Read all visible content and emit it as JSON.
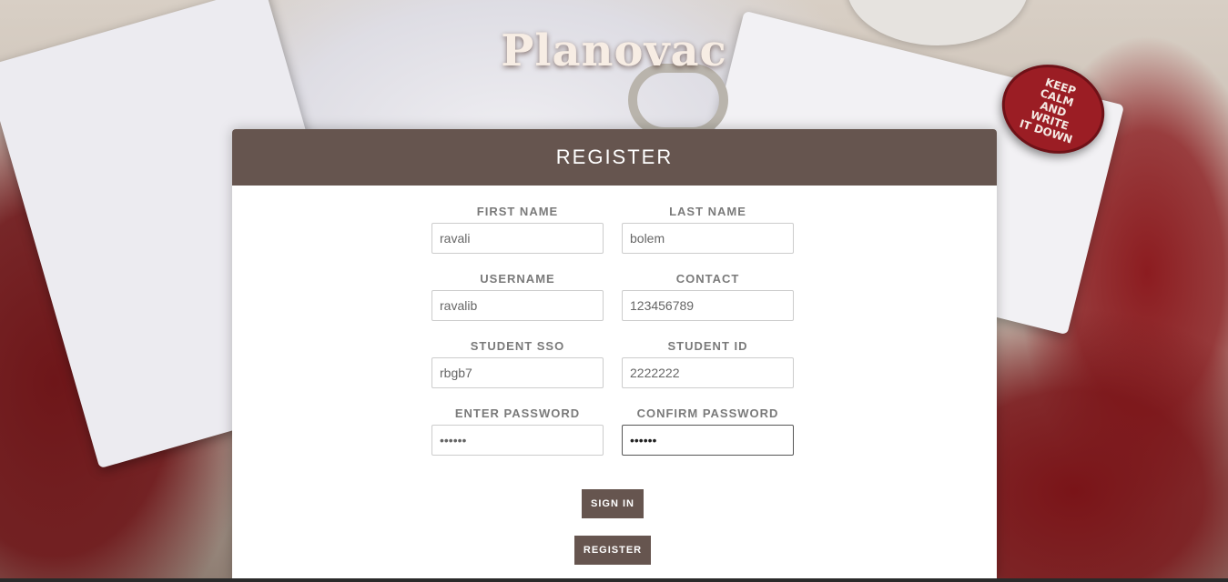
{
  "app": {
    "title": "Planovac"
  },
  "background": {
    "badge_text": "KEEP\nCALM\nAND\nWRITE\nIT DOWN"
  },
  "register_panel": {
    "heading": "REGISTER",
    "fields": {
      "first_name": {
        "label": "FIRST NAME",
        "value": "ravali"
      },
      "last_name": {
        "label": "LAST NAME",
        "value": "bolem"
      },
      "username": {
        "label": "USERNAME",
        "value": "ravalib"
      },
      "contact": {
        "label": "CONTACT",
        "value": "123456789"
      },
      "student_sso": {
        "label": "STUDENT SSO",
        "value": "rbgb7"
      },
      "student_id": {
        "label": "STUDENT ID",
        "value": "2222222"
      },
      "password": {
        "label": "ENTER PASSWORD",
        "value": "••••••"
      },
      "confirm_password": {
        "label": "CONFIRM PASSWORD",
        "value": "••••••"
      }
    },
    "buttons": {
      "sign_in": "SIGN IN",
      "register": "REGISTER"
    }
  },
  "colors": {
    "panel_header": "#66554f",
    "button": "#66554f"
  }
}
